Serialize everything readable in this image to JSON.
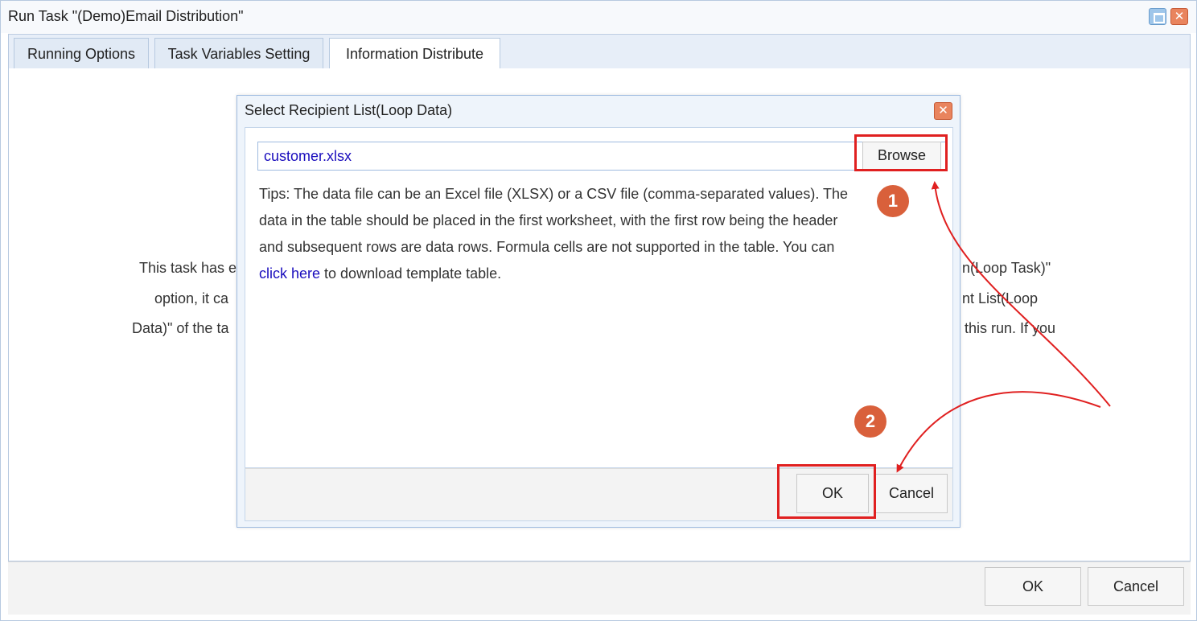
{
  "window": {
    "title": "Run Task \"(Demo)Email Distribution\""
  },
  "tabs": [
    {
      "label": "Running Options",
      "active": false
    },
    {
      "label": "Task Variables Setting",
      "active": false
    },
    {
      "label": "Information Distribute",
      "active": true
    }
  ],
  "background_text": {
    "line1_left": "This task has e",
    "line1_right": "n(Loop Task)\"",
    "line2_left": "option, it ca",
    "line2_right": "nt List(Loop",
    "line3_left": "Data)\" of the ta",
    "line3_right": "this run. If you"
  },
  "dialog": {
    "title": "Select Recipient List(Loop Data)",
    "file_value": "customer.xlsx",
    "browse_label": "Browse",
    "tips_before_link": "Tips: The data file can be an Excel file (XLSX) or a CSV file (comma-separated values). The data in the table should be placed in the first worksheet, with the first row being the header and subsequent rows are data rows. Formula cells are not supported in the table. You can ",
    "tips_link": "click here",
    "tips_after_link": " to download template table.",
    "ok_label": "OK",
    "cancel_label": "Cancel"
  },
  "footer": {
    "ok_label": "OK",
    "cancel_label": "Cancel"
  },
  "annotations": {
    "step1": "1",
    "step2": "2",
    "highlight_color": "#e02020",
    "badge_color": "#d9603b"
  },
  "icons": {
    "maximize": "maximize-icon",
    "close": "close-icon"
  }
}
